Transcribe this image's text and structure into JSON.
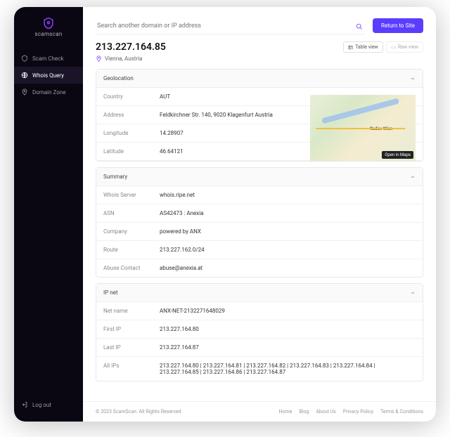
{
  "brand": "scamscan",
  "sidebar": {
    "items": [
      {
        "label": "Scam Check"
      },
      {
        "label": "Whois Query"
      },
      {
        "label": "Domain Zone"
      }
    ],
    "logout": "Log out"
  },
  "search": {
    "placeholder": "Search another domain or IP address"
  },
  "return_btn": "Return to Site",
  "ip_title": "213.227.164.85",
  "location_text": "Vienna, Austria",
  "view": {
    "table": "Table view",
    "raw": "Raw view"
  },
  "cards": {
    "geo": {
      "title": "Geolocation",
      "rows": {
        "country_l": "Country",
        "country_v": "AUT",
        "address_l": "Address",
        "address_v": "Feldkirchner Str. 140, 9020 Klagenfurt Austria",
        "long_l": "Longitude",
        "long_v": "14.28907",
        "lat_l": "Latitude",
        "lat_v": "46.64121"
      },
      "map_city": "Rudee Wien",
      "map_open": "Open in Maps"
    },
    "summary": {
      "title": "Summary",
      "rows": {
        "whois_l": "Whois Server",
        "whois_v": "whois.ripe.net",
        "asn_l": "ASN",
        "asn_v": "AS42473 : Anexia",
        "company_l": "Company",
        "company_v": "powered by ANX",
        "route_l": "Route",
        "route_v": "213.227.162.0/24",
        "abuse_l": "Abuse Contact",
        "abuse_v": "abuse@anexia.at"
      }
    },
    "ipnet": {
      "title": "IP net",
      "rows": {
        "netname_l": "Net name",
        "netname_v": "ANX-NET-2132271648029",
        "first_l": "First IP",
        "first_v": "213.227.164.80",
        "last_l": "Last IP",
        "last_v": "213.227.164.87",
        "all_l": "All IPs",
        "all_v": "213.227.164.80 | 213.227.164.81 | 213.227.164.82 | 213.227.164.83 | 213.227.164.84 | 213.227.164.85 | 213.227.164.86 | 213.227.164.87"
      }
    }
  },
  "footer": {
    "copy": "© 2023 ScamScan. All Rights Reserved",
    "links": [
      "Home",
      "Blog",
      "About Us",
      "Privacy Policy",
      "Terms & Conditions"
    ]
  }
}
